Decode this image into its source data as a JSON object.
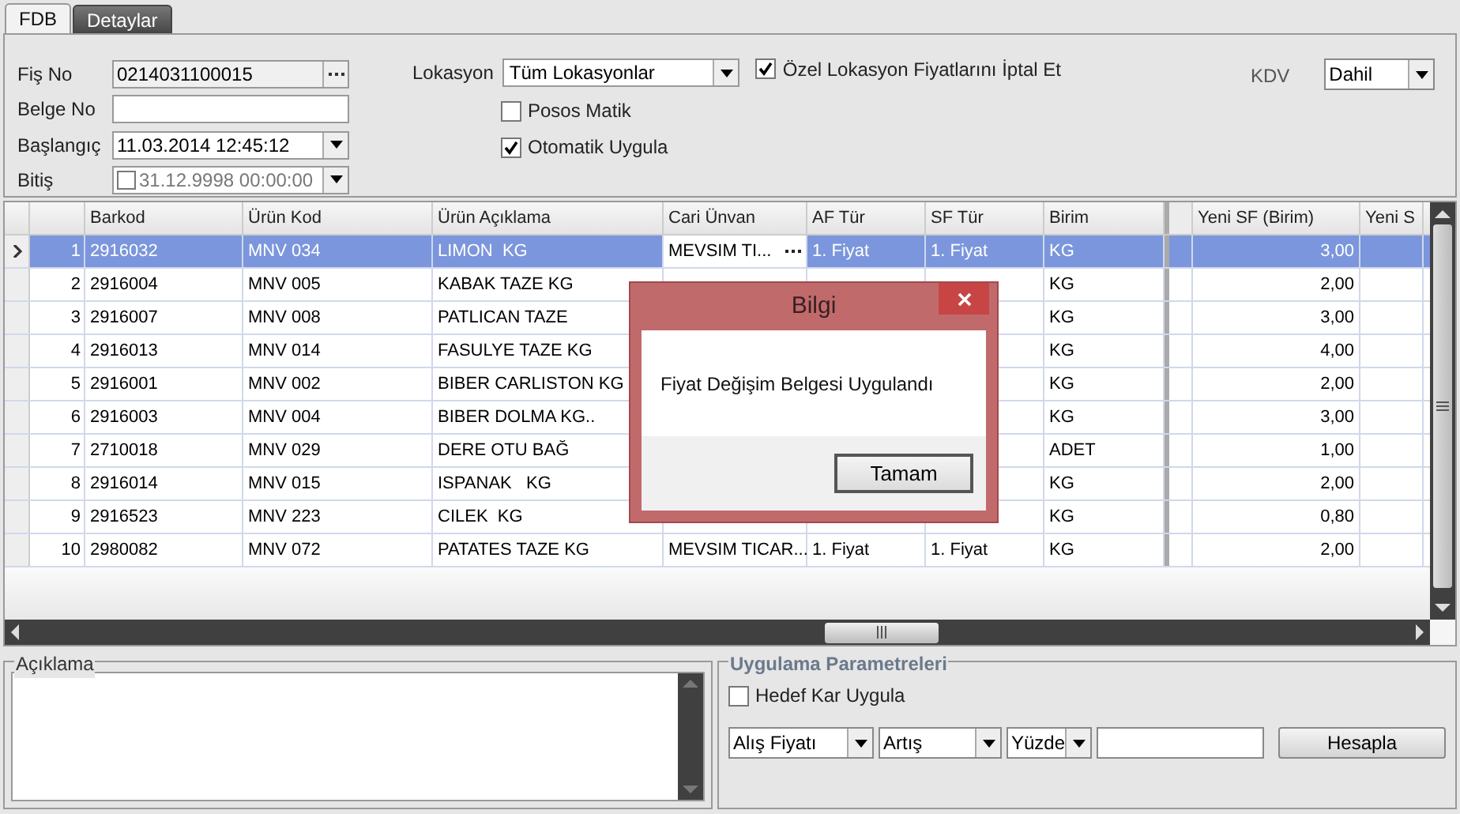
{
  "tabs": [
    {
      "label": "FDB",
      "selected": true
    },
    {
      "label": "Detaylar",
      "selected": false
    }
  ],
  "form": {
    "fis_no": {
      "label": "Fiş No",
      "value": "0214031100015"
    },
    "belge_no": {
      "label": "Belge No"
    },
    "baslangic": {
      "label": "Başlangıç",
      "value": "11.03.2014 12:45:12"
    },
    "bitis": {
      "label": "Bitiş",
      "value": "31.12.9998 00:00:00",
      "checked": false
    },
    "lokasyon": {
      "label": "Lokasyon",
      "value": "Tüm Lokasyonlar"
    },
    "options": [
      {
        "label": "Posos Matik",
        "checked": false
      },
      {
        "label": "Otomatik Uygula",
        "checked": true
      }
    ],
    "ozel": {
      "label": "Özel Lokasyon Fiyatlarını İptal Et",
      "checked": true
    },
    "kdv": {
      "label": "KDV",
      "value": "Dahil"
    }
  },
  "table": {
    "columns": [
      "Barkod",
      "Ürün Kod",
      "Ürün Açıklama",
      "Cari Ünvan",
      "AF Tür",
      "SF Tür",
      "Birim",
      "Yeni SF (Birim)",
      "Yeni S"
    ],
    "rows": [
      {
        "selected": true,
        "no": "1",
        "barkod": "2916032",
        "kod": "MNV 034",
        "aciklama": "LIMON  KG",
        "cari": "MEVSIM TI...",
        "af": "1. Fiyat",
        "sf": "1. Fiyat",
        "birim": "KG",
        "yeni_sf": "3,00"
      },
      {
        "selected": false,
        "no": "2",
        "barkod": "2916004",
        "kod": "MNV 005",
        "aciklama": "KABAK TAZE KG",
        "birim": "KG",
        "yeni_sf": "2,00"
      },
      {
        "selected": false,
        "no": "3",
        "barkod": "2916007",
        "kod": "MNV 008",
        "aciklama": "PATLICAN TAZE",
        "birim": "KG",
        "yeni_sf": "3,00"
      },
      {
        "selected": false,
        "no": "4",
        "barkod": "2916013",
        "kod": "MNV 014",
        "aciklama": "FASULYE TAZE KG",
        "birim": "KG",
        "yeni_sf": "4,00"
      },
      {
        "selected": false,
        "no": "5",
        "barkod": "2916001",
        "kod": "MNV 002",
        "aciklama": "BIBER CARLISTON KG",
        "birim": "KG",
        "yeni_sf": "2,00"
      },
      {
        "selected": false,
        "no": "6",
        "barkod": "2916003",
        "kod": "MNV 004",
        "aciklama": "BIBER DOLMA KG..",
        "birim": "KG",
        "yeni_sf": "3,00"
      },
      {
        "selected": false,
        "no": "7",
        "barkod": "2710018",
        "kod": "MNV 029",
        "aciklama": "DERE OTU BAĞ",
        "birim": "ADET",
        "yeni_sf": "1,00"
      },
      {
        "selected": false,
        "no": "8",
        "barkod": "2916014",
        "kod": "MNV 015",
        "aciklama": "ISPANAK   KG",
        "birim": "KG",
        "yeni_sf": "2,00"
      },
      {
        "selected": false,
        "no": "9",
        "barkod": "2916523",
        "kod": "MNV 223",
        "aciklama": "CILEK  KG",
        "birim": "KG",
        "yeni_sf": "0,80"
      },
      {
        "selected": false,
        "no": "10",
        "barkod": "2980082",
        "kod": "MNV 072",
        "aciklama": "PATATES TAZE KG",
        "cari": "MEVSIM TICAR...",
        "af": "1. Fiyat",
        "sf": "1. Fiyat",
        "birim": "KG",
        "yeni_sf": "2,00"
      }
    ]
  },
  "dialog": {
    "title": "Bilgi",
    "message": "Fiyat Değişim Belgesi Uygulandı",
    "button": "Tamam"
  },
  "aciklama": {
    "label": "Açıklama"
  },
  "uygulama": {
    "title": "Uygulama Parametreleri",
    "checkbox": {
      "label": "Hedef Kar Uygula",
      "checked": false
    },
    "selects": [
      "Alış Fiyatı",
      "Artış",
      "Yüzde"
    ],
    "button": "Hesapla"
  }
}
